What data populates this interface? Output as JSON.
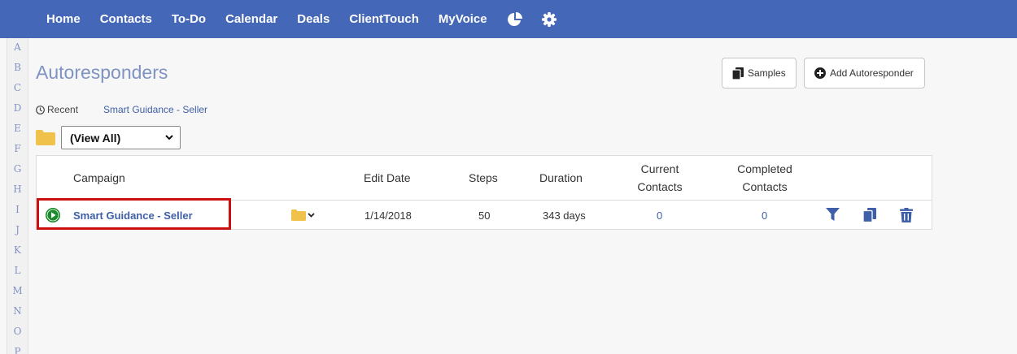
{
  "nav": {
    "items": [
      "Home",
      "Contacts",
      "To-Do",
      "Calendar",
      "Deals",
      "ClientTouch",
      "MyVoice"
    ],
    "icons": [
      "pie-chart-icon",
      "gear-icon"
    ]
  },
  "alphabet": [
    "A",
    "B",
    "C",
    "D",
    "E",
    "F",
    "G",
    "H",
    "I",
    "J",
    "K",
    "L",
    "M",
    "N",
    "O",
    "P"
  ],
  "page": {
    "title": "Autoresponders"
  },
  "buttons": {
    "samples": "Samples",
    "add": "Add Autoresponder"
  },
  "recent": {
    "label": "Recent",
    "link": "Smart Guidance - Seller"
  },
  "filter": {
    "selected": "(View All)"
  },
  "table": {
    "headers": {
      "campaign": "Campaign",
      "edit_date": "Edit Date",
      "steps": "Steps",
      "duration": "Duration",
      "current_contacts": "Current Contacts",
      "completed_contacts": "Completed Contacts"
    },
    "rows": [
      {
        "campaign": "Smart Guidance - Seller",
        "edit_date": "1/14/2018",
        "steps": "50",
        "duration": "343 days",
        "current_contacts": "0",
        "completed_contacts": "0"
      }
    ]
  },
  "colors": {
    "navbar": "#4567b7",
    "title": "#7f93c3",
    "link": "#3f5fa8",
    "highlight": "#cc1010",
    "play": "#1a8a2a",
    "folder": "#f0c14b"
  }
}
